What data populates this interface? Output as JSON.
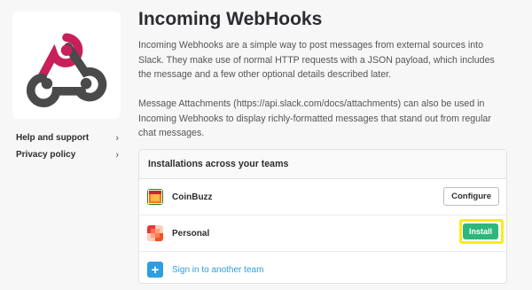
{
  "app": {
    "title": "Incoming WebHooks",
    "logo_icon": "webhooks-logo-icon",
    "colors": {
      "accent_green": "#2eb67d",
      "link_blue": "#2d9ee0",
      "highlight_yellow": "#f5ec1e"
    }
  },
  "sidebar": {
    "items": [
      {
        "label": "Help and support",
        "icon": "chevron-right-icon"
      },
      {
        "label": "Privacy policy",
        "icon": "chevron-right-icon"
      }
    ]
  },
  "main": {
    "paragraphs": [
      "Incoming Webhooks are a simple way to post messages from external sources into Slack. They make use of normal HTTP requests with a JSON payload, which includes the message and a few other optional details described later.",
      "Message Attachments (https://api.slack.com/docs/attachments) can also be used in Incoming Webhooks to display richly-formatted messages that stand out from regular chat messages."
    ],
    "installations": {
      "header": "Installations across your teams",
      "teams": [
        {
          "name": "CoinBuzz",
          "action_label": "Configure"
        },
        {
          "name": "Personal",
          "action_label": "Install"
        }
      ],
      "add_team_label": "Sign in to another team",
      "add_icon": "plus-icon"
    }
  }
}
